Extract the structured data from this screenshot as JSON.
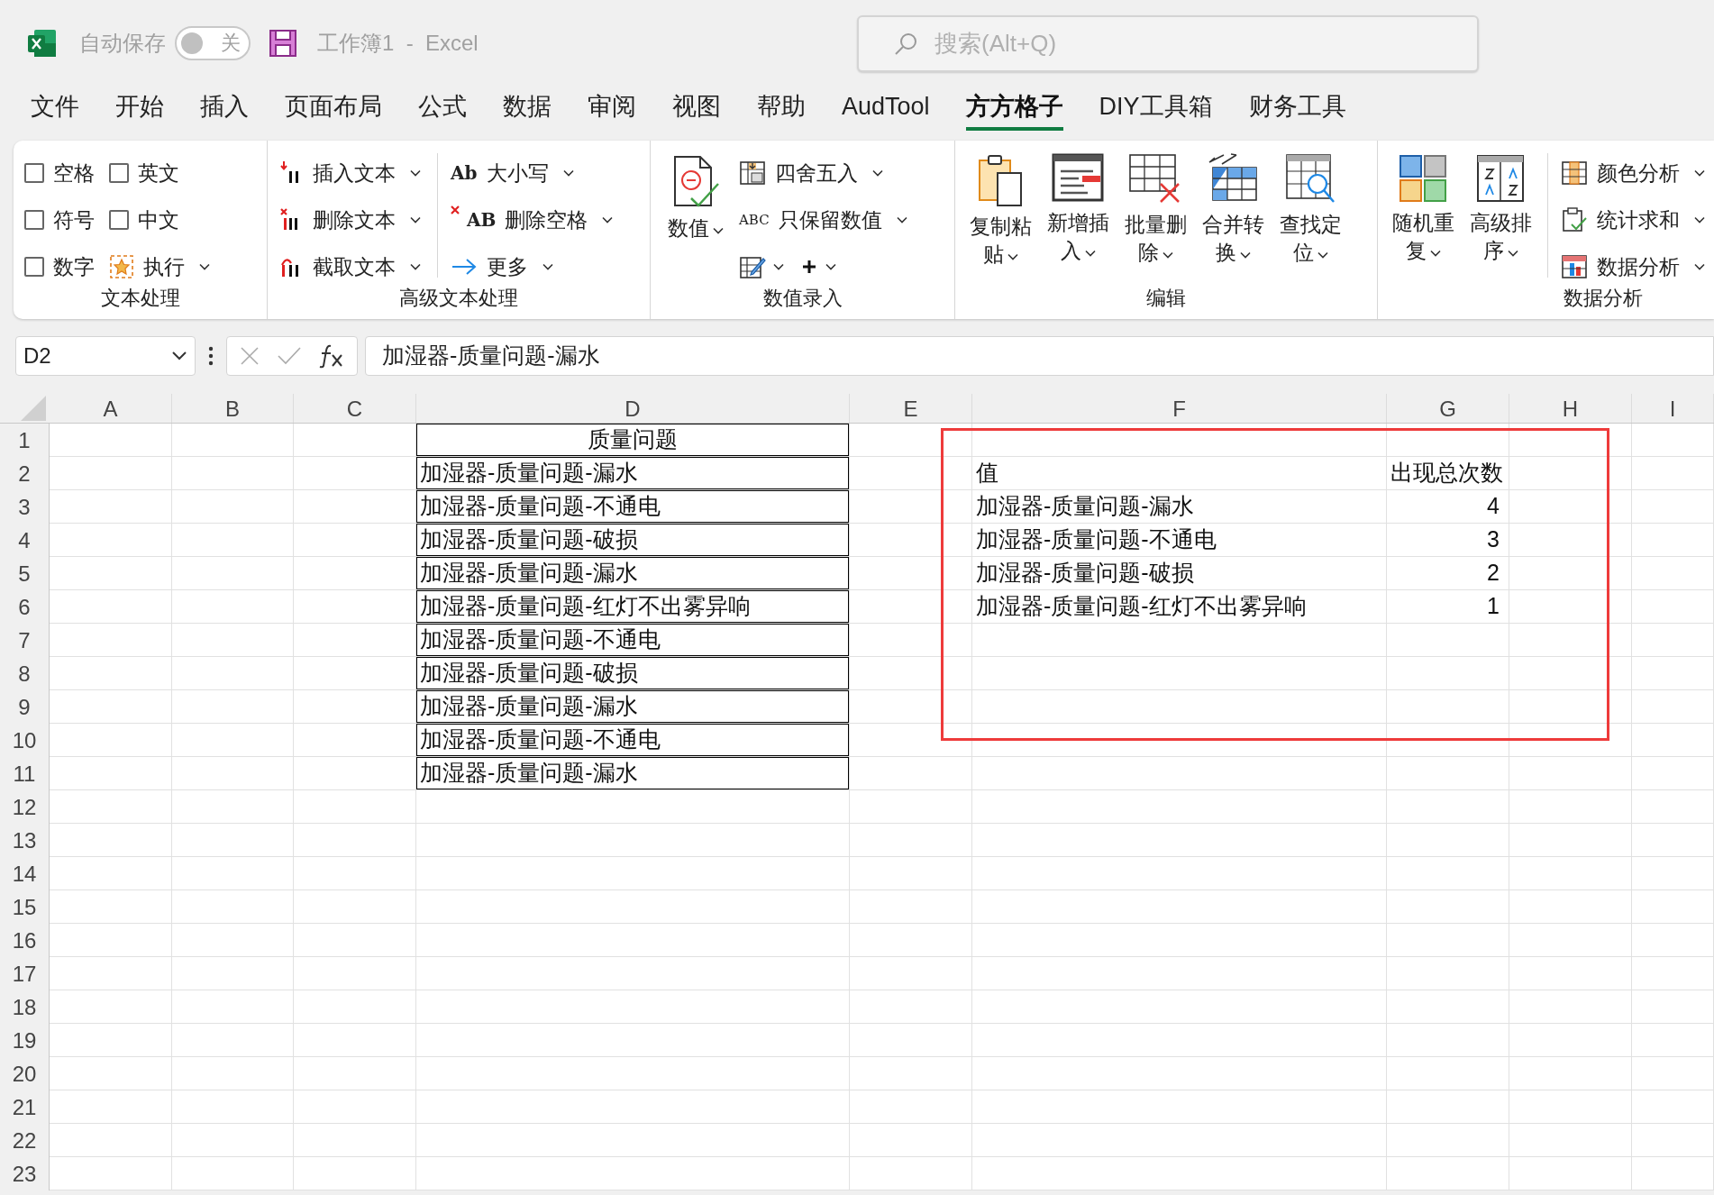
{
  "title_bar": {
    "autosave_label": "自动保存",
    "autosave": {
      "on": false,
      "label": "关"
    },
    "document_title": "工作簿1  -  Excel",
    "search": {
      "placeholder": "搜索(Alt+Q)"
    }
  },
  "menu_tabs": [
    {
      "label": "文件",
      "selected": false
    },
    {
      "label": "开始",
      "selected": false
    },
    {
      "label": "插入",
      "selected": false
    },
    {
      "label": "页面布局",
      "selected": false
    },
    {
      "label": "公式",
      "selected": false
    },
    {
      "label": "数据",
      "selected": false
    },
    {
      "label": "审阅",
      "selected": false
    },
    {
      "label": "视图",
      "selected": false
    },
    {
      "label": "帮助",
      "selected": false
    },
    {
      "label": "AudTool",
      "selected": false
    },
    {
      "label": "方方格子",
      "selected": true
    },
    {
      "label": "DIY工具箱",
      "selected": false
    },
    {
      "label": "财务工具",
      "selected": false
    }
  ],
  "ribbon": {
    "groups": [
      {
        "label": "文本处理",
        "columns": [
          {
            "kind": "stack",
            "items": [
              {
                "kind": "checkbox",
                "label": "空格",
                "checked": false
              },
              {
                "kind": "checkbox",
                "label": "符号",
                "checked": false
              },
              {
                "kind": "checkbox",
                "label": "数字",
                "checked": false
              }
            ]
          },
          {
            "kind": "stack",
            "items": [
              {
                "kind": "checkbox",
                "label": "英文",
                "checked": false
              },
              {
                "kind": "checkbox",
                "label": "中文",
                "checked": false
              },
              {
                "kind": "small",
                "label": "执行",
                "menu": true
              }
            ]
          }
        ]
      },
      {
        "label": "高级文本处理",
        "columns": [
          {
            "kind": "stack",
            "items": [
              {
                "kind": "small",
                "label": "插入文本",
                "menu": true
              },
              {
                "kind": "small",
                "label": "删除文本",
                "menu": true
              },
              {
                "kind": "small",
                "label": "截取文本",
                "menu": true
              }
            ]
          },
          {
            "kind": "separator"
          },
          {
            "kind": "stack",
            "items": [
              {
                "kind": "small",
                "icon_text": "Ab",
                "label": "大小写",
                "menu": true
              },
              {
                "kind": "small",
                "icon_text": "AB",
                "label": "删除空格",
                "menu": true
              },
              {
                "kind": "small",
                "label": "更多",
                "menu": true
              }
            ]
          }
        ]
      },
      {
        "label": "数值录入",
        "columns": [
          {
            "kind": "stack",
            "items": [
              {
                "kind": "large",
                "label": "数值",
                "menu": true
              }
            ]
          },
          {
            "kind": "stack",
            "items": [
              {
                "kind": "small",
                "label": "四舍五入",
                "menu": true
              },
              {
                "kind": "small",
                "icon_text": "ABC",
                "label": "只保留数值",
                "menu": true
              },
              {
                "kind": "icon_row",
                "buttons": [
                  {
                    "menu": true
                  },
                  {
                    "menu": true
                  }
                ]
              }
            ]
          }
        ]
      },
      {
        "label": "编辑",
        "columns": [
          {
            "kind": "stack",
            "items": [
              {
                "kind": "large",
                "label": "复制粘贴",
                "menu": true
              }
            ]
          },
          {
            "kind": "stack",
            "items": [
              {
                "kind": "large",
                "label": "新增插入",
                "menu": true
              }
            ]
          },
          {
            "kind": "stack",
            "items": [
              {
                "kind": "large",
                "label": "批量删除",
                "menu": true
              }
            ]
          },
          {
            "kind": "stack",
            "items": [
              {
                "kind": "large",
                "label": "合并转换",
                "menu": true
              }
            ]
          },
          {
            "kind": "stack",
            "items": [
              {
                "kind": "large",
                "label": "查找定位",
                "menu": true
              }
            ]
          }
        ]
      },
      {
        "label": "数据分析",
        "columns": [
          {
            "kind": "stack",
            "items": [
              {
                "kind": "large",
                "label": "随机重复",
                "menu": true
              }
            ]
          },
          {
            "kind": "stack",
            "items": [
              {
                "kind": "large",
                "label": "高级排序",
                "menu": true
              }
            ]
          },
          {
            "kind": "separator"
          },
          {
            "kind": "stack",
            "items": [
              {
                "kind": "small",
                "label": "颜色分析",
                "menu": true
              },
              {
                "kind": "small",
                "label": "统计求和",
                "menu": true
              },
              {
                "kind": "small",
                "label": "数据分析",
                "menu": true
              }
            ]
          }
        ]
      }
    ]
  },
  "formula_bar": {
    "name_box": "D2",
    "formula": "加湿器-质量问题-漏水"
  },
  "sheet": {
    "columns": [
      "A",
      "B",
      "C",
      "D",
      "E",
      "F",
      "G",
      "H",
      "I"
    ],
    "rows": [
      {
        "number": "1",
        "cells": {
          "D": {
            "text": "质量问题",
            "kind": "heading",
            "bordered": true
          }
        }
      },
      {
        "number": "2",
        "cells": {
          "D": {
            "text": "加湿器-质量问题-漏水",
            "kind": "text",
            "bordered": true
          },
          "F": {
            "text": "值",
            "kind": "text",
            "bordered": false
          },
          "G": {
            "text": "出现总次数",
            "kind": "text",
            "bordered": false
          }
        }
      },
      {
        "number": "3",
        "cells": {
          "D": {
            "text": "加湿器-质量问题-不通电",
            "kind": "text",
            "bordered": true
          },
          "F": {
            "text": "加湿器-质量问题-漏水",
            "kind": "text",
            "bordered": false
          },
          "G": {
            "text": "4",
            "kind": "number",
            "bordered": false
          }
        }
      },
      {
        "number": "4",
        "cells": {
          "D": {
            "text": "加湿器-质量问题-破损",
            "kind": "text",
            "bordered": true
          },
          "F": {
            "text": "加湿器-质量问题-不通电",
            "kind": "text",
            "bordered": false
          },
          "G": {
            "text": "3",
            "kind": "number",
            "bordered": false
          }
        }
      },
      {
        "number": "5",
        "cells": {
          "D": {
            "text": "加湿器-质量问题-漏水",
            "kind": "text",
            "bordered": true
          },
          "F": {
            "text": "加湿器-质量问题-破损",
            "kind": "text",
            "bordered": false
          },
          "G": {
            "text": "2",
            "kind": "number",
            "bordered": false
          }
        }
      },
      {
        "number": "6",
        "cells": {
          "D": {
            "text": "加湿器-质量问题-红灯不出雾异响",
            "kind": "text",
            "bordered": true
          },
          "F": {
            "text": "加湿器-质量问题-红灯不出雾异响",
            "kind": "text",
            "bordered": false
          },
          "G": {
            "text": "1",
            "kind": "number",
            "bordered": false
          }
        }
      },
      {
        "number": "7",
        "cells": {
          "D": {
            "text": "加湿器-质量问题-不通电",
            "kind": "text",
            "bordered": true
          }
        }
      },
      {
        "number": "8",
        "cells": {
          "D": {
            "text": "加湿器-质量问题-破损",
            "kind": "text",
            "bordered": true
          }
        }
      },
      {
        "number": "9",
        "cells": {
          "D": {
            "text": "加湿器-质量问题-漏水",
            "kind": "text",
            "bordered": true
          }
        }
      },
      {
        "number": "10",
        "cells": {
          "D": {
            "text": "加湿器-质量问题-不通电",
            "kind": "text",
            "bordered": true
          }
        }
      },
      {
        "number": "11",
        "cells": {
          "D": {
            "text": "加湿器-质量问题-漏水",
            "kind": "text",
            "bordered": true
          }
        }
      },
      {
        "number": "12",
        "cells": {}
      },
      {
        "number": "13",
        "cells": {}
      },
      {
        "number": "14",
        "cells": {}
      },
      {
        "number": "15",
        "cells": {}
      },
      {
        "number": "16",
        "cells": {}
      },
      {
        "number": "17",
        "cells": {}
      },
      {
        "number": "18",
        "cells": {}
      },
      {
        "number": "19",
        "cells": {}
      },
      {
        "number": "20",
        "cells": {}
      },
      {
        "number": "21",
        "cells": {}
      },
      {
        "number": "22",
        "cells": {}
      },
      {
        "number": "23",
        "cells": {}
      }
    ],
    "annotation_box": true
  }
}
